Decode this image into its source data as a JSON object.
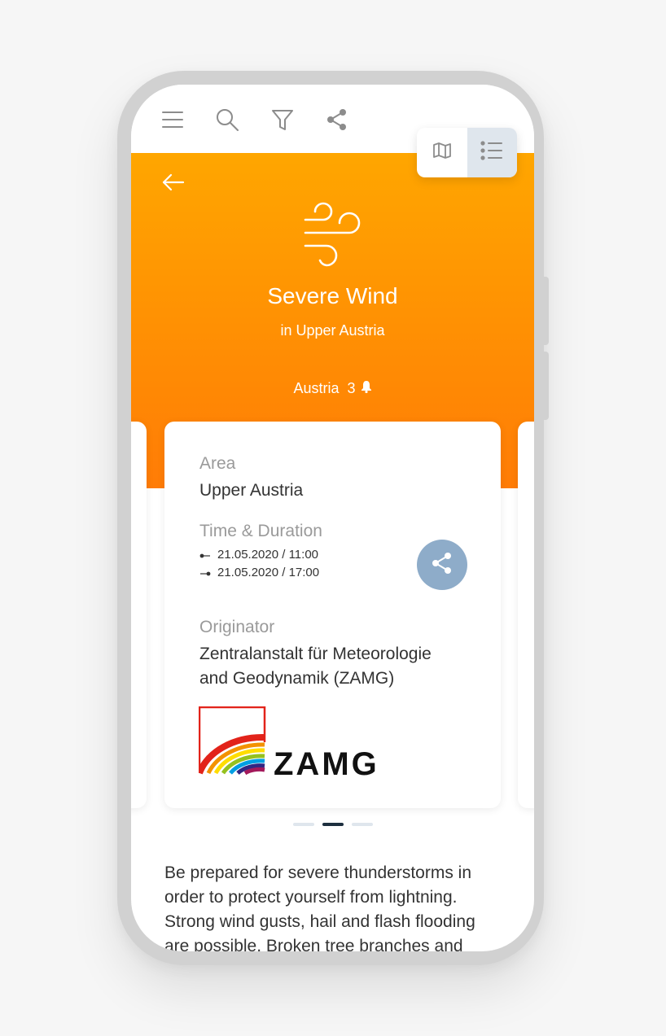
{
  "hero": {
    "title": "Severe Wind",
    "subtitle": "in Upper Austria",
    "region": "Austria",
    "alert_count": "3"
  },
  "card": {
    "area_label": "Area",
    "area_value": "Upper Austria",
    "time_label": "Time & Duration",
    "start": "21.05.2020 / 11:00",
    "end": "21.05.2020 / 17:00",
    "originator_label": "Originator",
    "originator_line1": "Zentralanstalt für Meteorologie",
    "originator_line2": "and Geodynamik (ZAMG)",
    "logo_text": "ZAMG"
  },
  "pager": {
    "count": 3,
    "active_index": 1
  },
  "description": "Be prepared for severe thunderstorms in order to protect yourself from lightning. Strong wind gusts, hail and flash flooding are possible. Broken tree branches and",
  "colors": {
    "hero_top": "#ffa600",
    "hero_bottom": "#ff7c06",
    "fab": "#8eacc9",
    "active_toggle": "#dfe6ed",
    "pager_active": "#1d2f3f"
  },
  "icons": {
    "toolbar": [
      "menu-icon",
      "search-icon",
      "filter-icon",
      "share-icon"
    ],
    "view_toggle": [
      "map-icon",
      "list-icon"
    ],
    "hazard": "wind-icon"
  }
}
